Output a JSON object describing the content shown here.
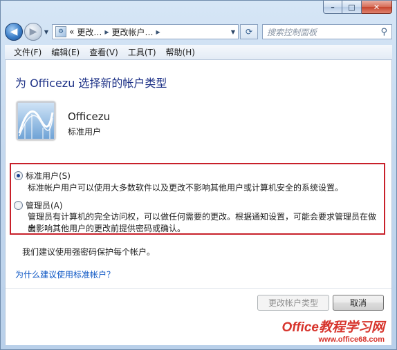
{
  "window": {
    "buttons": {
      "minimize": "–",
      "maximize": "□",
      "close": "✕"
    }
  },
  "navbar": {
    "back_icon": "back-arrow-icon",
    "forward_icon": "forward-arrow-icon",
    "address": {
      "prefix": "«",
      "crumbs": [
        "更改…",
        "更改帐户…"
      ]
    },
    "search_placeholder": "搜索控制面板"
  },
  "menubar": {
    "items": [
      "文件(F)",
      "编辑(E)",
      "查看(V)",
      "工具(T)",
      "帮助(H)"
    ]
  },
  "main": {
    "title": "为 Officezu 选择新的帐户类型",
    "account": {
      "name": "Officezu",
      "role": "标准用户"
    },
    "options": [
      {
        "label": "标准用户(S)",
        "selected": true,
        "description": [
          "标准帐户用户可以使用大多数软件以及更改不影响其他用户或计算机安全的系统设置。"
        ]
      },
      {
        "label": "管理员(A)",
        "selected": false,
        "description": [
          "管理员有计算机的完全访问权，可以做任何需要的更改。根据通知设置，可能会要求管理员在做出",
          "会影响其他用户的更改前提供密码或确认。"
        ]
      }
    ],
    "recommendation": "我们建议使用强密码保护每个帐户。",
    "why_link": "为什么建议使用标准帐户？",
    "buttons": {
      "change": "更改帐户类型",
      "cancel": "取消"
    }
  },
  "watermark": {
    "text": "Office教程学习网",
    "url": "www.office68.com"
  },
  "colors": {
    "accent_title": "#1e3287",
    "link": "#0b55c4",
    "highlight_border": "#c8202a"
  }
}
